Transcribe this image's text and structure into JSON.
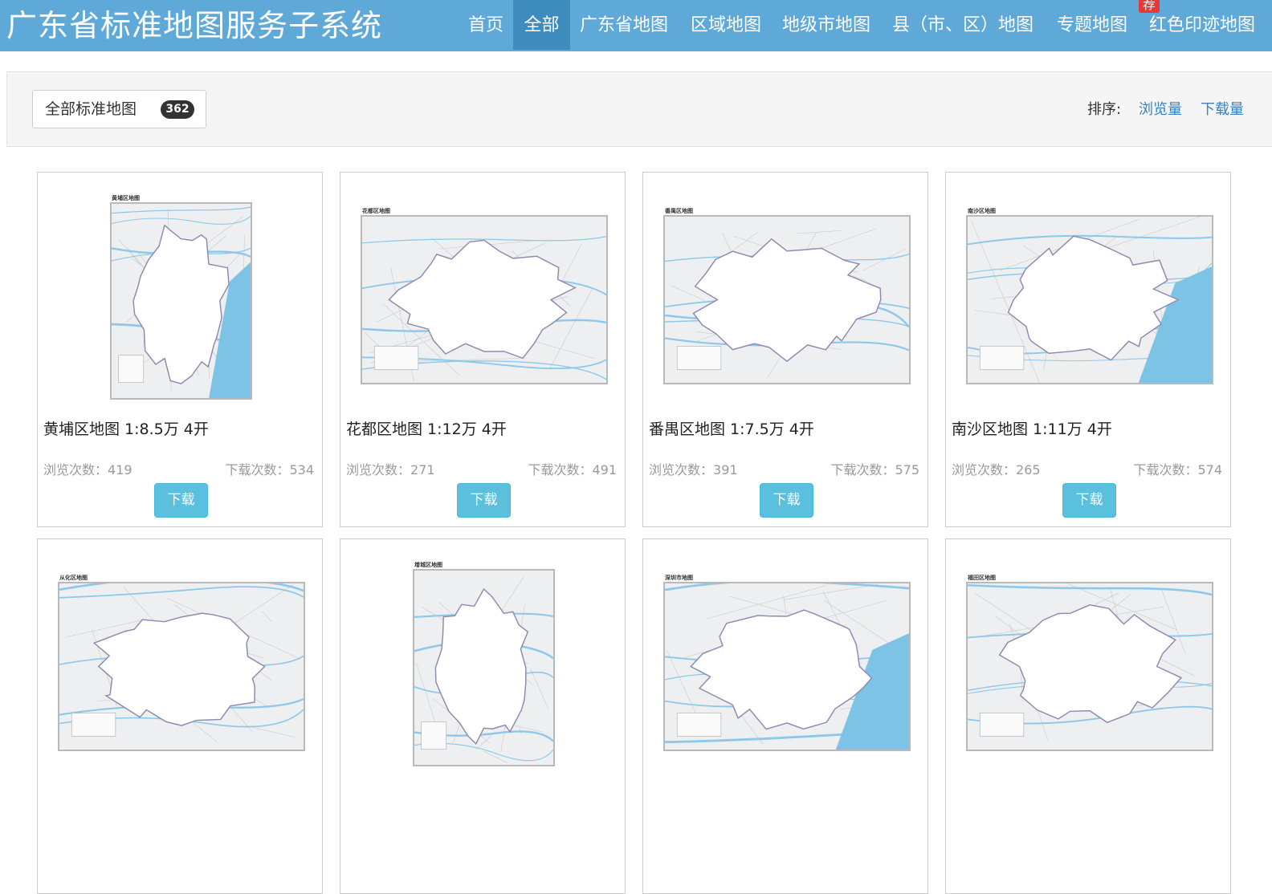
{
  "site_title": "广东省标准地图服务子系统",
  "nav": {
    "items": [
      "首页",
      "全部",
      "广东省地图",
      "区域地图",
      "地级市地图",
      "县（市、区）地图",
      "专题地图",
      "红色印迹地图"
    ],
    "active_index": 1,
    "badge": "荐"
  },
  "filter": {
    "label": "全部标准地图",
    "count": "362",
    "sort_label": "排序:",
    "sort_views": "浏览量",
    "sort_downloads": "下载量"
  },
  "cards": [
    {
      "thumb_title": "黄埔区地图",
      "title": "黄埔区地图 1:8.5万 4开",
      "views_label": "浏览次数：",
      "views": "419",
      "downloads_label": "下载次数：",
      "downloads": "534",
      "button": "下载",
      "orientation": "portrait"
    },
    {
      "thumb_title": "花都区地图",
      "title": "花都区地图 1:12万 4开",
      "views_label": "浏览次数：",
      "views": "271",
      "downloads_label": "下载次数：",
      "downloads": "491",
      "button": "下载",
      "orientation": "landscape"
    },
    {
      "thumb_title": "番禺区地图",
      "title": "番禺区地图 1:7.5万 4开",
      "views_label": "浏览次数：",
      "views": "391",
      "downloads_label": "下载次数：",
      "downloads": "575",
      "button": "下载",
      "orientation": "landscape"
    },
    {
      "thumb_title": "南沙区地图",
      "title": "南沙区地图 1:11万 4开",
      "views_label": "浏览次数：",
      "views": "265",
      "downloads_label": "下载次数：",
      "downloads": "574",
      "button": "下载",
      "orientation": "landscape"
    },
    {
      "thumb_title": "从化区地图",
      "orientation": "landscape"
    },
    {
      "thumb_title": "增城区地图",
      "orientation": "portrait"
    },
    {
      "thumb_title": "深圳市地图",
      "orientation": "landscape"
    },
    {
      "thumb_title": "福田区地图",
      "orientation": "landscape"
    }
  ],
  "colors": {
    "header_bg": "#5fa9d8",
    "nav_active": "#3d8cbd",
    "badge": "#e53935",
    "button": "#5bc0de",
    "link": "#3a7fc1"
  }
}
